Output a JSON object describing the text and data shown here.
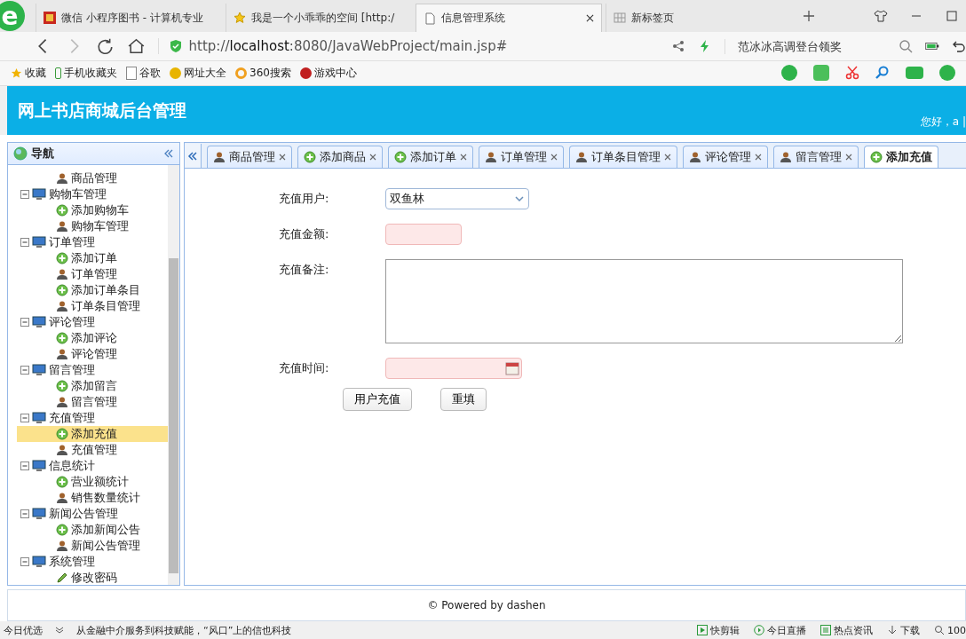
{
  "browser": {
    "tabs": [
      {
        "title": "微信 小程序图书 - 计算机专业",
        "kind": "red",
        "selected": false,
        "closable": false
      },
      {
        "title": "我是一个小乖乖的空间 [http:/",
        "kind": "star",
        "selected": false,
        "closable": false
      },
      {
        "title": "信息管理系统",
        "kind": "page",
        "selected": true,
        "closable": true
      },
      {
        "title": "新标签页",
        "kind": "grid",
        "selected": false,
        "closable": false
      }
    ],
    "logo": "e",
    "url": "http://**localhost**:8080/JavaWebProject/main.jsp#",
    "search": {
      "placeholder": "范冰冰高调登台领奖"
    },
    "bookmarks": [
      {
        "label": "收藏",
        "kind": "star"
      },
      {
        "label": "手机收藏夹",
        "kind": "phone"
      },
      {
        "label": "谷歌",
        "kind": "page"
      },
      {
        "label": "网址大全",
        "kind": "plus"
      },
      {
        "label": "360搜索",
        "kind": "ring"
      },
      {
        "label": "游戏中心",
        "kind": "game"
      }
    ]
  },
  "app": {
    "title": "网上书店商城后台管理",
    "greeting": "您好，a |"
  },
  "nav": {
    "title": "导航",
    "tree": [
      {
        "children": [
          {
            "label": "商品管理",
            "kind": "manage",
            "selected": false
          }
        ]
      },
      {
        "label": "购物车管理",
        "expanded": true,
        "children": [
          {
            "label": "添加购物车",
            "kind": "add",
            "selected": false
          },
          {
            "label": "购物车管理",
            "kind": "manage",
            "selected": false
          }
        ]
      },
      {
        "label": "订单管理",
        "expanded": true,
        "children": [
          {
            "label": "添加订单",
            "kind": "add",
            "selected": false
          },
          {
            "label": "订单管理",
            "kind": "manage",
            "selected": false
          },
          {
            "label": "添加订单条目",
            "kind": "add",
            "selected": false
          },
          {
            "label": "订单条目管理",
            "kind": "manage",
            "selected": false
          }
        ]
      },
      {
        "label": "评论管理",
        "expanded": true,
        "children": [
          {
            "label": "添加评论",
            "kind": "add",
            "selected": false
          },
          {
            "label": "评论管理",
            "kind": "manage",
            "selected": false
          }
        ]
      },
      {
        "label": "留言管理",
        "expanded": true,
        "children": [
          {
            "label": "添加留言",
            "kind": "add",
            "selected": false
          },
          {
            "label": "留言管理",
            "kind": "manage",
            "selected": false
          }
        ]
      },
      {
        "label": "充值管理",
        "expanded": true,
        "children": [
          {
            "label": "添加充值",
            "kind": "add",
            "selected": true
          },
          {
            "label": "充值管理",
            "kind": "manage",
            "selected": false
          }
        ]
      },
      {
        "label": "信息统计",
        "expanded": true,
        "children": [
          {
            "label": "营业额统计",
            "kind": "add",
            "selected": false
          },
          {
            "label": "销售数量统计",
            "kind": "manage",
            "selected": false
          }
        ]
      },
      {
        "label": "新闻公告管理",
        "expanded": true,
        "children": [
          {
            "label": "添加新闻公告",
            "kind": "add",
            "selected": false
          },
          {
            "label": "新闻公告管理",
            "kind": "manage",
            "selected": false
          }
        ]
      },
      {
        "label": "系统管理",
        "expanded": true,
        "children": [
          {
            "label": "修改密码",
            "kind": "edit",
            "selected": false
          }
        ]
      }
    ]
  },
  "tabs": [
    {
      "label": "商品管理",
      "kind": "manage",
      "selected": false,
      "closable": true
    },
    {
      "label": "添加商品",
      "kind": "add",
      "selected": false,
      "closable": true
    },
    {
      "label": "添加订单",
      "kind": "add",
      "selected": false,
      "closable": true
    },
    {
      "label": "订单管理",
      "kind": "manage",
      "selected": false,
      "closable": true
    },
    {
      "label": "订单条目管理",
      "kind": "manage",
      "selected": false,
      "closable": true
    },
    {
      "label": "评论管理",
      "kind": "manage",
      "selected": false,
      "closable": true
    },
    {
      "label": "留言管理",
      "kind": "manage",
      "selected": false,
      "closable": true
    },
    {
      "label": "添加充值",
      "kind": "add",
      "selected": true,
      "closable": false
    }
  ],
  "form": {
    "fields": [
      {
        "label": "充值用户:",
        "kind": "select",
        "value": "双鱼林",
        "invalid": false
      },
      {
        "label": "充值金额:",
        "kind": "text",
        "invalid": true
      },
      {
        "label": "充值备注:",
        "kind": "textarea",
        "invalid": false
      },
      {
        "label": "充值时间:",
        "kind": "date",
        "invalid": true
      }
    ],
    "buttons": [
      "用户充值",
      "重填"
    ]
  },
  "footer": "© Powered by dashen",
  "status_bar": {
    "left": "今日优选",
    "news": "从金融中介服务到科技赋能，“风口”上的信也科技",
    "items": [
      {
        "label": "快剪辑",
        "kind": "clip"
      },
      {
        "label": "今日直播",
        "kind": "play"
      },
      {
        "label": "热点资讯",
        "kind": "news"
      },
      {
        "label": "下载",
        "kind": "download"
      },
      {
        "label": "100",
        "kind": "zoom"
      }
    ]
  }
}
